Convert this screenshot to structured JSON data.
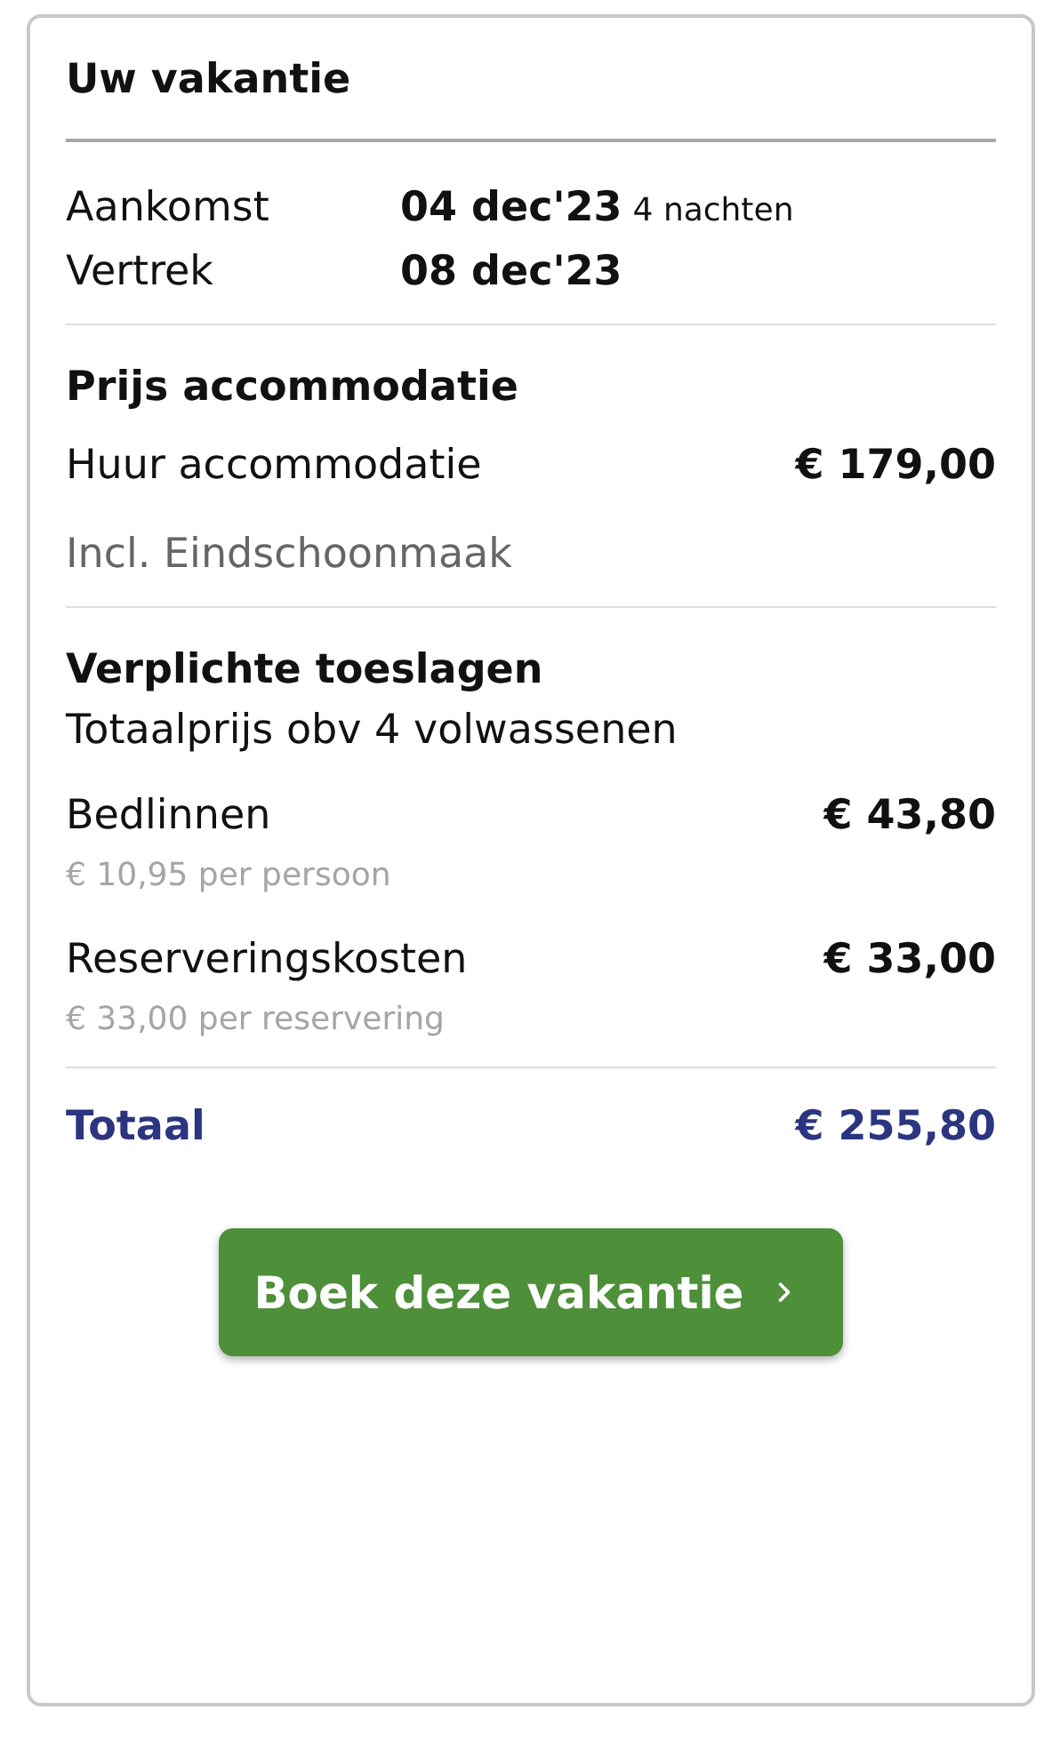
{
  "title": "Uw vakantie",
  "dates": [
    {
      "label": "Aankomst",
      "value": "04 dec'23",
      "note": "4 nachten"
    },
    {
      "label": "Vertrek",
      "value": "08 dec'23"
    }
  ],
  "sections": [
    {
      "heading": "Prijs accommodatie",
      "items": [
        {
          "label": "Huur accommodatie",
          "amount": "€ 179,00"
        }
      ],
      "note": "Incl. Eindschoonmaak"
    },
    {
      "heading": "Verplichte toeslagen",
      "subheading": "Totaalprijs obv 4 volwassenen",
      "items": [
        {
          "label": "Bedlinnen",
          "amount": "€ 43,80",
          "detail": "€ 10,95 per persoon"
        },
        {
          "label": "Reserveringskosten",
          "amount": "€ 33,00",
          "detail": "€ 33,00 per reservering"
        }
      ]
    }
  ],
  "total": {
    "label": "Totaal",
    "amount": "€ 255,80"
  },
  "button": {
    "label": "Boek deze vakantie"
  }
}
